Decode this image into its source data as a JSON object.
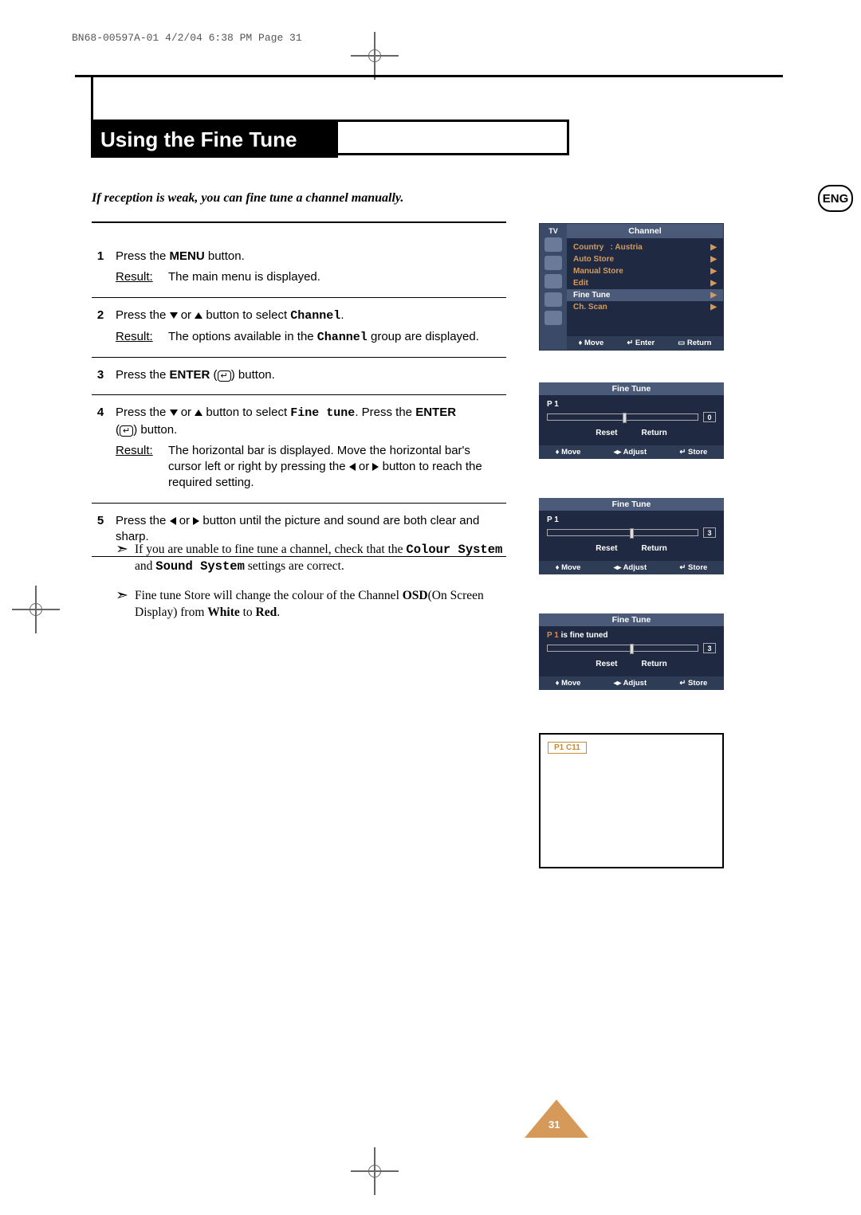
{
  "header": "BN68-00597A-01  4/2/04  6:38 PM  Page 31",
  "title": "Using the Fine Tune",
  "lang_badge": "ENG",
  "intro": "If reception is weak, you can fine tune a channel manually.",
  "steps": {
    "s1": {
      "num": "1",
      "line_pre": "Press the ",
      "line_bold": "MENU",
      "line_post": " button.",
      "result_label": "Result:",
      "result": "The main menu is displayed."
    },
    "s2": {
      "num": "2",
      "line_a": "Press the ",
      "line_b": " or ",
      "line_c": " button to select ",
      "mono": "Channel",
      "line_d": ".",
      "result_label": "Result:",
      "result_a": "The options available in the ",
      "result_mono": "Channel",
      "result_b": " group are displayed."
    },
    "s3": {
      "num": "3",
      "line_a": "Press the  ",
      "line_bold": "ENTER",
      "line_b": " (",
      "line_c": ") button."
    },
    "s4": {
      "num": "4",
      "line_a": "Press the ",
      "line_b": " or ",
      "line_c": " button to select ",
      "mono": "Fine tune",
      "line_d": ". Press the  ",
      "line_bold": "ENTER",
      "line_e": "(",
      "line_f": ") button.",
      "result_label": "Result:",
      "result_a": "The horizontal bar is displayed. Move the horizontal bar's cursor left or right by pressing the ",
      "result_b": " or ",
      "result_c": " button to reach the required setting."
    },
    "s5": {
      "num": "5",
      "line_a": "Press the ",
      "line_b": " or ",
      "line_c": " button until the picture and sound are both clear and sharp."
    }
  },
  "notes": {
    "n1_a": "If you are unable to fine tune a channel, check that the ",
    "n1_mono1": "Colour System",
    "n1_b": " and ",
    "n1_mono2": "Sound System",
    "n1_c": " settings are correct.",
    "n2_a": "Fine tune Store will change the colour of the Channel ",
    "n2_bold1": "OSD",
    "n2_b": "(On Screen Display) from ",
    "n2_bold2": "White",
    "n2_c": " to ",
    "n2_bold3": "Red",
    "n2_d": "."
  },
  "osd1": {
    "tv": "TV",
    "title": "Channel",
    "rows": [
      {
        "label": "Country",
        "value": ":  Austria"
      },
      {
        "label": "Auto Store",
        "value": ""
      },
      {
        "label": "Manual Store",
        "value": ""
      },
      {
        "label": "Edit",
        "value": ""
      },
      {
        "label": "Fine Tune",
        "value": "",
        "selected": true
      },
      {
        "label": "Ch. Scan",
        "value": ""
      }
    ],
    "footer": {
      "move": "Move",
      "enter": "Enter",
      "return": "Return"
    }
  },
  "osd_ft": {
    "title": "Fine Tune",
    "p1": "P 1",
    "tuned_suffix": "  is fine tuned",
    "reset": "Reset",
    "return": "Return",
    "footer": {
      "move": "Move",
      "adjust": "Adjust",
      "store": "Store"
    }
  },
  "ft_vals": {
    "v1": "0",
    "v2": "3",
    "v3": "3"
  },
  "preview": {
    "label": "P1    C11"
  },
  "pagenum": "31",
  "chart_data": null
}
